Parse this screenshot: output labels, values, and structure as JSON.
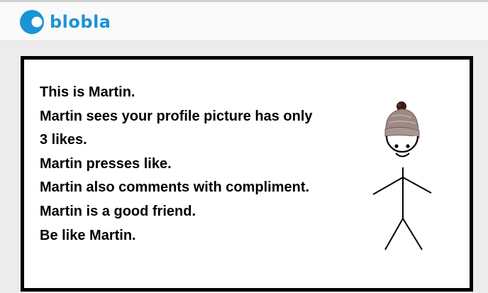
{
  "header": {
    "brand": "blobla",
    "brand_color": "#1b94d3"
  },
  "meme": {
    "lines": [
      "This is Martin.",
      "Martin sees your profile picture has only",
      "3 likes.",
      "Martin presses like.",
      "Martin also comments with compliment.",
      "Martin is a good friend.",
      "Be like Martin."
    ],
    "figure_icon": "stick-figure-with-beanie"
  }
}
